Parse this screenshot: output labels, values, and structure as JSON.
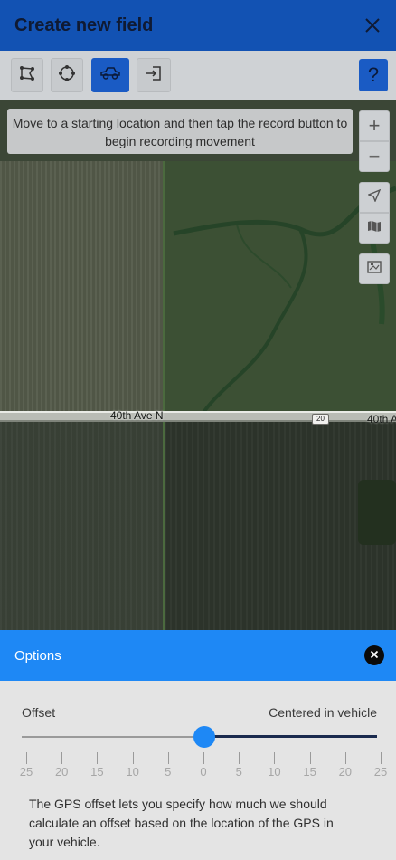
{
  "header": {
    "title": "Create new field",
    "close_icon": "close-icon"
  },
  "toolbar": {
    "tools": [
      {
        "name": "draw-boundary",
        "icon": "polygon-icon",
        "active": false
      },
      {
        "name": "pivot",
        "icon": "pivot-circle-icon",
        "active": false
      },
      {
        "name": "drive-record",
        "icon": "vehicle-icon",
        "active": true
      },
      {
        "name": "import",
        "icon": "import-icon",
        "active": false
      }
    ],
    "help_label": "?"
  },
  "map": {
    "hint": "Move to a starting location and then tap the record button to begin recording movement",
    "road_label": "40th Ave N",
    "road_label_right": "40th A",
    "route_shield": "20",
    "controls": {
      "zoom_in": "+",
      "zoom_out": "−"
    }
  },
  "options": {
    "title": "Options",
    "offset_label": "Offset",
    "offset_value": "Centered in vehicle",
    "slider": {
      "min": -25,
      "max": 25,
      "value": 0,
      "ticks": [
        "25",
        "20",
        "15",
        "10",
        "5",
        "0",
        "5",
        "10",
        "15",
        "20",
        "25"
      ]
    },
    "description": "The GPS offset lets you specify how much we should calculate an offset based on the location of the GPS in your vehicle."
  },
  "colors": {
    "header_bg": "#1252b3",
    "accent": "#1e88f5",
    "active_tool": "#1a5bc4"
  }
}
